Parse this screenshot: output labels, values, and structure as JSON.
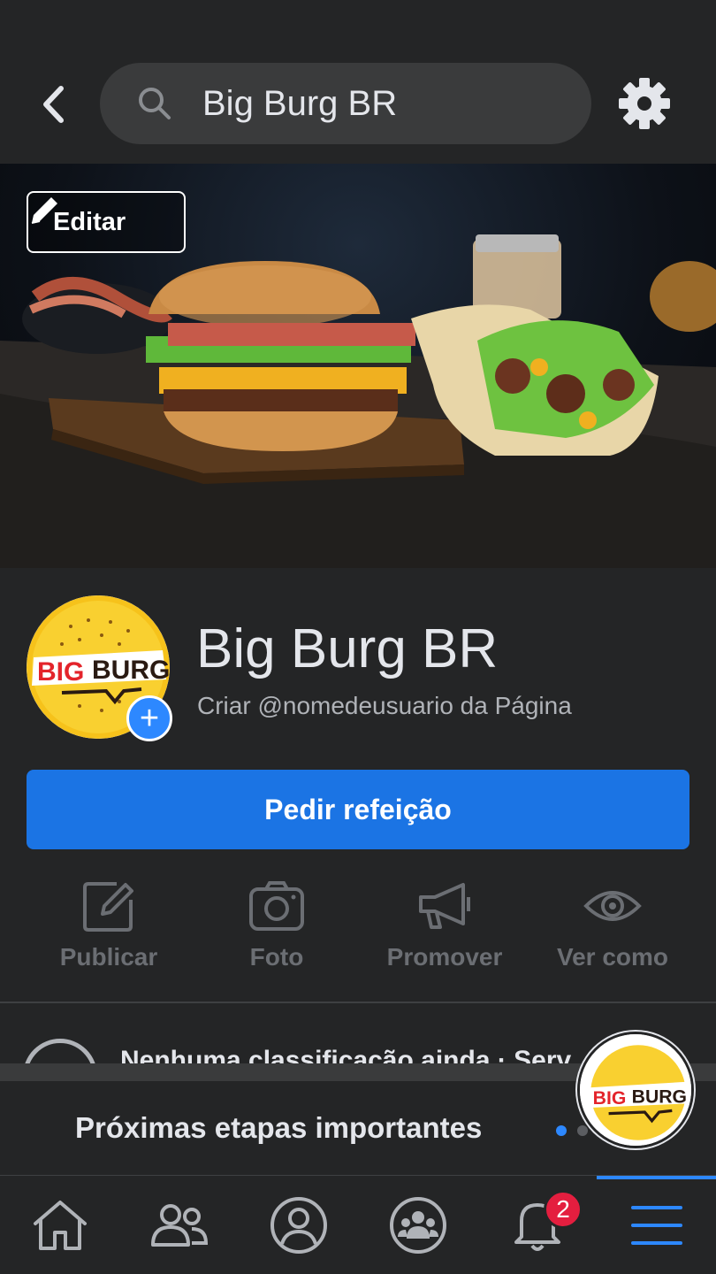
{
  "search": {
    "query": "Big Burg BR"
  },
  "cover": {
    "edit_label": "Editar"
  },
  "profile": {
    "name": "Big Burg BR",
    "username_prompt": "Criar @nomedeusuario da Página",
    "logo_text_left": "BIG",
    "logo_text_right": "BURG"
  },
  "primary_action": {
    "label": "Pedir refeição"
  },
  "actions": [
    {
      "label": "Publicar",
      "icon": "edit-square-icon"
    },
    {
      "label": "Foto",
      "icon": "camera-icon"
    },
    {
      "label": "Promover",
      "icon": "megaphone-icon"
    },
    {
      "label": "Ver como",
      "icon": "eye-icon"
    }
  ],
  "rating": {
    "text": "Nenhuma classificação ainda · Serv"
  },
  "next_steps": {
    "title": "Próximas etapas importantes"
  },
  "navbar": {
    "items": [
      "home-icon",
      "friends-icon",
      "profile-icon",
      "groups-icon",
      "bell-icon",
      "menu-icon"
    ],
    "notifications_count": "2",
    "active": "menu-icon"
  },
  "colors": {
    "accent": "#1b74e4",
    "badge": "#e41e3f",
    "background": "#242526"
  }
}
